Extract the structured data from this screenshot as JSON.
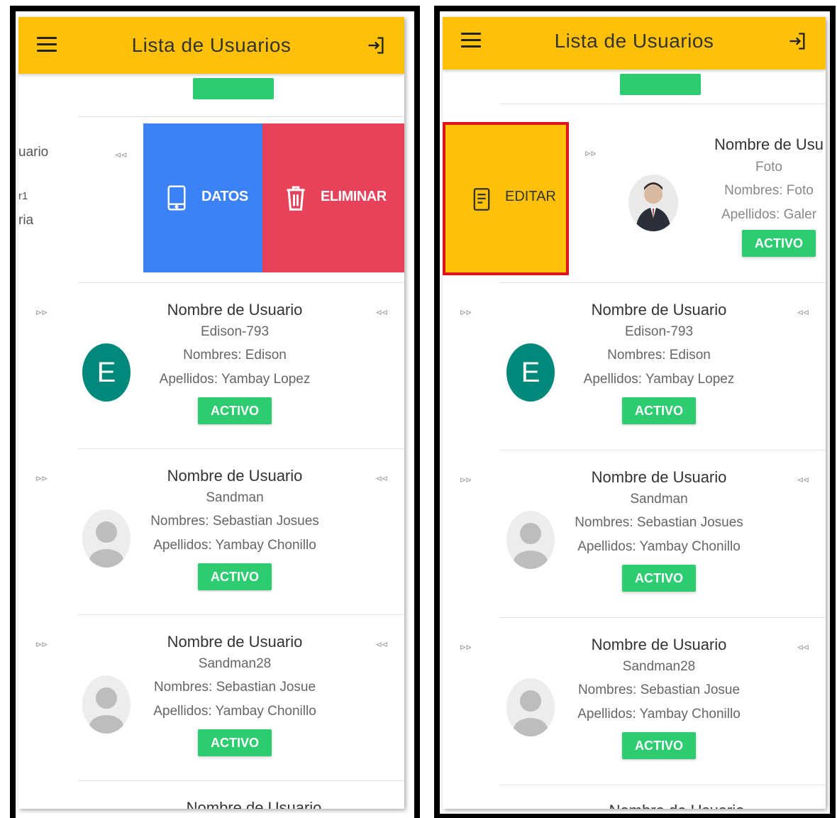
{
  "app": {
    "title": "Lista de Usuarios"
  },
  "left_panel": {
    "swiped_card": {
      "ghost_lines": [
        "uario",
        "r1",
        "ria"
      ],
      "actions": {
        "datos": "DATOS",
        "eliminar": "ELIMINAR"
      }
    },
    "users": [
      {
        "name_label": "Nombre de Usuario",
        "username": "Edison-793",
        "nombres": "Nombres: Edison",
        "apellidos": "Apellidos: Yambay Lopez",
        "status": "ACTIVO",
        "avatar_letter": "E"
      },
      {
        "name_label": "Nombre de Usuario",
        "username": "Sandman",
        "nombres": "Nombres: Sebastian Josues",
        "apellidos": "Apellidos: Yambay Chonillo",
        "status": "ACTIVO"
      },
      {
        "name_label": "Nombre de Usuario",
        "username": "Sandman28",
        "nombres": "Nombres: Sebastian Josue",
        "apellidos": "Apellidos: Yambay Chonillo",
        "status": "ACTIVO"
      }
    ],
    "bottom_partial": "Nombre de Usuario"
  },
  "right_panel": {
    "swiped_card": {
      "name_label": "Nombre de Usu",
      "username": "Foto",
      "nombres": "Nombres: Foto",
      "apellidos": "Apellidos: Galer",
      "status": "ACTIVO",
      "action_editar": "EDITAR"
    },
    "users": [
      {
        "name_label": "Nombre de Usuario",
        "username": "Edison-793",
        "nombres": "Nombres: Edison",
        "apellidos": "Apellidos: Yambay Lopez",
        "status": "ACTIVO",
        "avatar_letter": "E"
      },
      {
        "name_label": "Nombre de Usuario",
        "username": "Sandman",
        "nombres": "Nombres: Sebastian Josues",
        "apellidos": "Apellidos: Yambay Chonillo",
        "status": "ACTIVO"
      },
      {
        "name_label": "Nombre de Usuario",
        "username": "Sandman28",
        "nombres": "Nombres: Sebastian Josue",
        "apellidos": "Apellidos: Yambay Chonillo",
        "status": "ACTIVO"
      }
    ],
    "bottom_partial": "Nombre de Usuario"
  },
  "colors": {
    "appbar": "#ffc107",
    "active_badge": "#2ecc71",
    "datos_action": "#3b82f6",
    "eliminar_action": "#e8425a",
    "editar_action": "#ffc107",
    "highlight_border": "#e0141b",
    "letter_avatar": "#00897b"
  },
  "icons": {
    "menu": "menu-icon",
    "logout": "logout-icon",
    "swipe_left": "swipe-left-icon",
    "swipe_right": "swipe-right-icon",
    "datos": "phone-icon",
    "eliminar": "trash-icon",
    "editar": "document-icon"
  }
}
